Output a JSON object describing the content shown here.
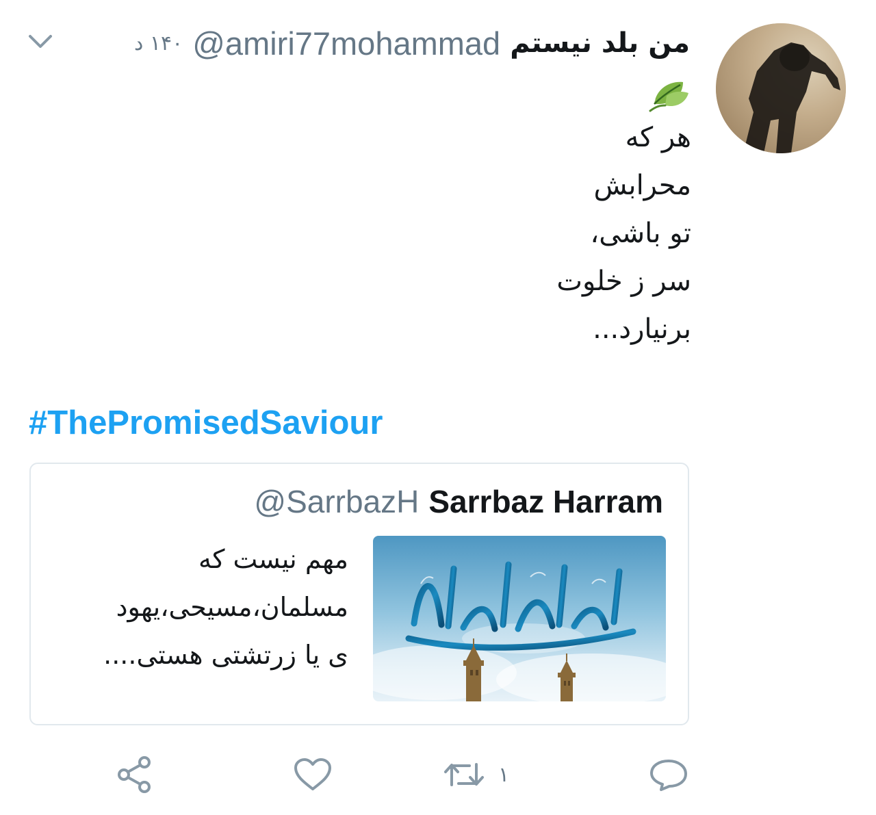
{
  "tweet": {
    "author": {
      "display_name": "من بلد نیستم",
      "handle": "@amiri77mohammad"
    },
    "timestamp": "۱۴۰ د",
    "leading_emoji": "leaf-emoji",
    "lines": [
      "هر که",
      "محرابش",
      "تو باشی،",
      "سر ز خلوت",
      "برنیارد..."
    ],
    "hashtag": "#ThePromisedSaviour"
  },
  "quoted_tweet": {
    "display_name": "Sarrbaz Harram",
    "handle": "@SarrbazH",
    "lines": [
      "مهم نیست که",
      "مسلمان،مسیحی،یهود",
      "ی یا زرتشتی هستی...."
    ],
    "image_icon": "calligraphy-image"
  },
  "actions": {
    "reply_icon": "reply-icon",
    "retweet_icon": "retweet-icon",
    "retweet_count": "۱",
    "like_icon": "heart-icon",
    "share_icon": "share-icon"
  },
  "colors": {
    "text": "#14171a",
    "secondary": "#657786",
    "link": "#1da1f2",
    "border": "#e1e8ed"
  }
}
